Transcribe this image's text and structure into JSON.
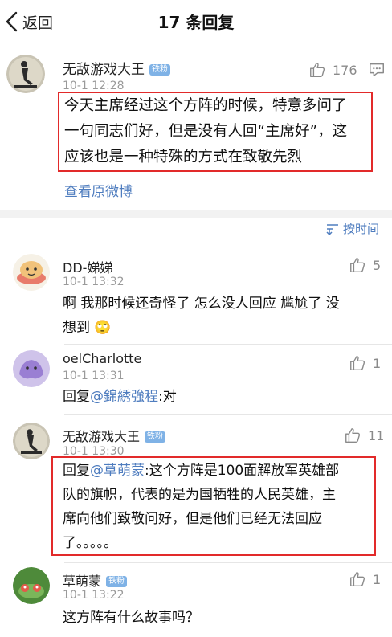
{
  "header": {
    "back_label": "返回",
    "title": "17 条回复"
  },
  "main_post": {
    "username": "无敌游戏大王",
    "badge": "铁粉",
    "time": "10-1 12:28",
    "likes": "176",
    "text_lines": [
      "今天主席经过这个方阵的时候，特意多问了",
      "一句同志们好，但是没有人回“主席好”，这",
      "应该也是一种特殊的方式在致敬先烈"
    ],
    "link": "查看原微博"
  },
  "sort": {
    "label": "按时间"
  },
  "replies": [
    {
      "username": "DD-娣娣",
      "time": "10-1 13:32",
      "likes": "5",
      "lines": [
        "啊 我那时候还奇怪了 怎么没人回应 尴尬了 没",
        "想到"
      ],
      "emoji": "🙄"
    },
    {
      "username": "oelCharlotte",
      "time": "10-1 13:31",
      "likes": "1",
      "prefix": "回复",
      "mention": "@錦綉強程",
      "suffix": ":对"
    },
    {
      "username": "无敌游戏大王",
      "badge": "铁粉",
      "time": "10-1 13:30",
      "likes": "11",
      "prefix": "回复",
      "mention": "@草萌蒙",
      "line1_rest": ":这个方阵是100面解放军英雄部",
      "lines": [
        "队的旗帜，代表的是为国牺牲的人民英雄，主",
        "席向他们致敬问好，但是他们已经无法回应",
        "了。。。。。"
      ]
    },
    {
      "username": "草萌蒙",
      "badge": "铁粉",
      "time": "10-1 13:22",
      "likes": "1",
      "lines": [
        "这方阵有什么故事吗？"
      ]
    }
  ]
}
